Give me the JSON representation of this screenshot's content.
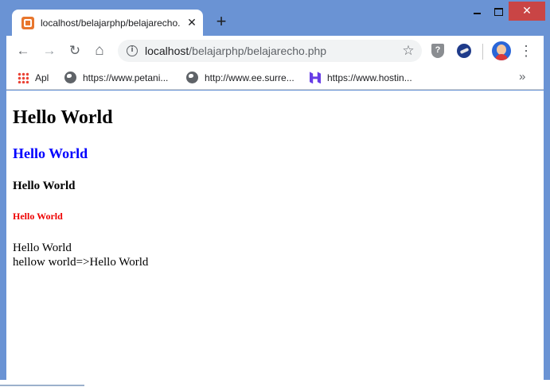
{
  "browser": {
    "tab": {
      "title": "localhost/belajarphp/belajarecho.php",
      "favicon": "xampp-icon"
    },
    "new_tab_symbol": "+",
    "tab_close_symbol": "✕",
    "window_controls": {
      "close_symbol": "✕"
    },
    "toolbar": {
      "back_symbol": "←",
      "forward_symbol": "→",
      "reload_symbol": "↻",
      "home_symbol": "⌂",
      "info_symbol": "i",
      "star_symbol": "☆",
      "menu_symbol": "⋮",
      "shield_symbol": "?"
    },
    "omnibox": {
      "host": "localhost",
      "path": "/belajarphp/belajarecho.php"
    },
    "bookmarks": [
      {
        "label": "Apl",
        "icon": "apps-grid-icon"
      },
      {
        "label": "https://www.petani...",
        "icon": "globe-icon"
      },
      {
        "label": "http://www.ee.surre...",
        "icon": "globe-icon"
      },
      {
        "label": "https://www.hostin...",
        "icon": "hostinger-icon"
      }
    ],
    "bookmarks_more_symbol": "»"
  },
  "page": {
    "heading1": "Hello World",
    "heading2": "Hello World",
    "heading3": "Hello World",
    "heading4": "Hello World",
    "line1": "Hello World",
    "line2": "hellow world=>Hello World"
  },
  "colors": {
    "titlebar": "#6a93d4",
    "close_button": "#c94545",
    "heading2": "#0000ff",
    "heading4": "#ee0000"
  }
}
